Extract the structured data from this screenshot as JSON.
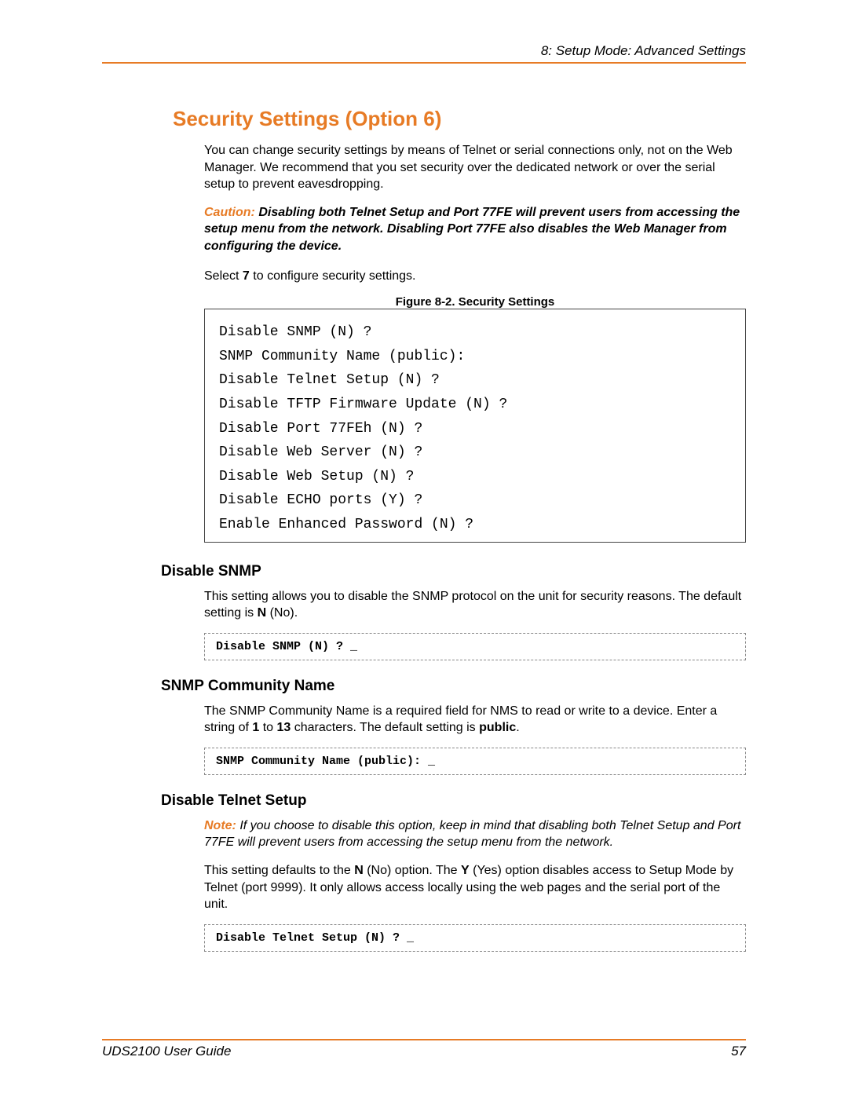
{
  "header": {
    "running_head": "8: Setup Mode: Advanced Settings"
  },
  "section_title": "Security Settings (Option 6)",
  "intro_para": "You can change security settings by means of Telnet or serial connections only, not on the Web Manager. We recommend that you set security over the dedicated network or over the serial setup to prevent eavesdropping.",
  "caution": {
    "label": "Caution:",
    "text": " Disabling both Telnet Setup and Port 77FE will prevent users from accessing the setup menu from the network. Disabling Port 77FE also disables the Web Manager from configuring the device."
  },
  "select7_pre": "Select ",
  "select7_bold": "7",
  "select7_post": " to configure security settings.",
  "figure": {
    "caption": "Figure 8-2. Security Settings",
    "lines": [
      "Disable SNMP (N) ?",
      "SNMP Community Name (public):",
      "Disable Telnet Setup (N) ?",
      "Disable TFTP Firmware Update (N) ?",
      "Disable Port 77FEh (N) ?",
      "Disable Web Server (N) ?",
      "Disable Web Setup (N) ?",
      "Disable ECHO ports (Y) ?",
      "Enable Enhanced Password (N) ?"
    ]
  },
  "disable_snmp": {
    "heading": "Disable SNMP",
    "para_pre": "This setting allows you to disable the SNMP protocol on the unit for security reasons. The default setting is ",
    "para_bold": "N",
    "para_post": " (No).",
    "prompt": "Disable SNMP (N) ? _"
  },
  "snmp_community": {
    "heading": "SNMP Community Name",
    "para_pre": "The SNMP Community Name is a required field for NMS to read or write to a device. Enter a string of ",
    "bold1": "1",
    "mid1": " to ",
    "bold2": "13",
    "mid2": " characters. The default setting is ",
    "bold3": "public",
    "post": ".",
    "prompt": "SNMP Community Name (public): _"
  },
  "disable_telnet": {
    "heading": "Disable Telnet Setup",
    "note_label": "Note:",
    "note_text": " If you choose to disable this option, keep in mind that disabling both Telnet Setup and Port 77FE will prevent users from accessing the setup menu from the network.",
    "para_pre": "This setting defaults to the ",
    "bold1": "N",
    "mid1": " (No) option. The ",
    "bold2": "Y",
    "mid2": " (Yes) option disables access to Setup Mode by Telnet (port 9999). It only allows access locally using the web pages and the serial port of the unit.",
    "prompt": "Disable Telnet Setup (N) ? _"
  },
  "footer": {
    "guide": "UDS2100 User Guide",
    "page": "57"
  }
}
